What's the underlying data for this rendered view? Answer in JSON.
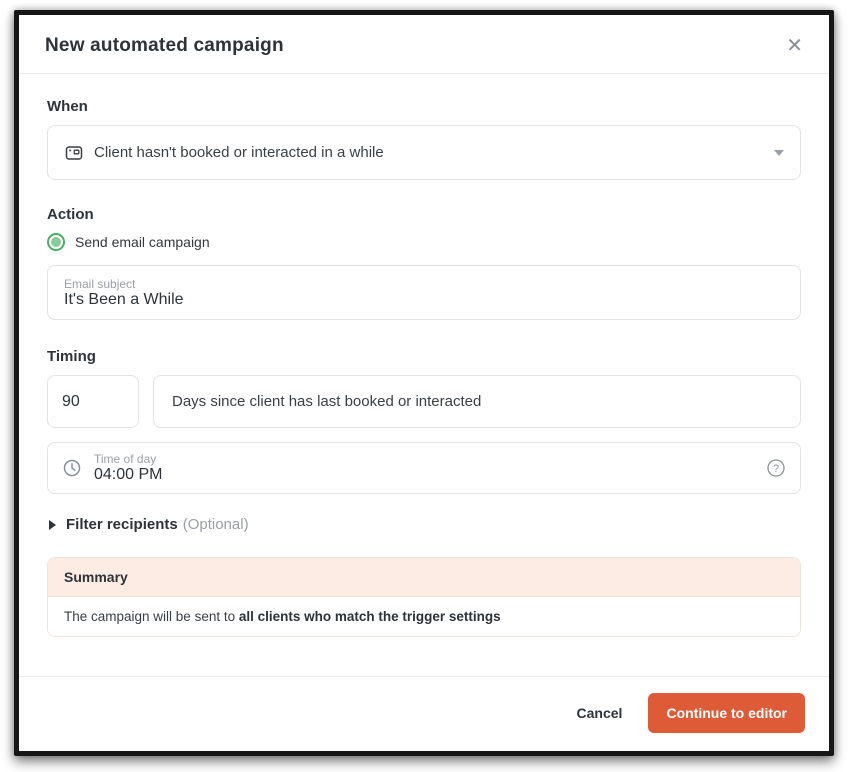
{
  "dialog": {
    "title": "New automated campaign",
    "close_glyph": "✕"
  },
  "when": {
    "label": "When",
    "trigger_icon": "calendar-booking-icon",
    "trigger_value": "Client hasn't booked or interacted in a while"
  },
  "action": {
    "label": "Action",
    "radio_label": "Send email campaign",
    "email_subject_label": "Email subject",
    "email_subject_value": "It's Been a While"
  },
  "timing": {
    "label": "Timing",
    "days_value": "90",
    "days_description": "Days since client has last booked or interacted",
    "time_of_day_label": "Time of day",
    "time_of_day_value": "04:00 PM"
  },
  "filter": {
    "label": "Filter recipients",
    "optional": "(Optional)"
  },
  "summary": {
    "title": "Summary",
    "text_prefix": "The campaign will be sent to ",
    "text_bold": "all clients who match the trigger settings"
  },
  "footer": {
    "cancel_label": "Cancel",
    "continue_label": "Continue to editor"
  },
  "colors": {
    "accent_orange": "#dd5b37",
    "radio_green_ring": "#4bae63",
    "radio_green_dot": "#85cd99",
    "summary_header_bg": "#fcece4",
    "frame_border": "#161616"
  }
}
